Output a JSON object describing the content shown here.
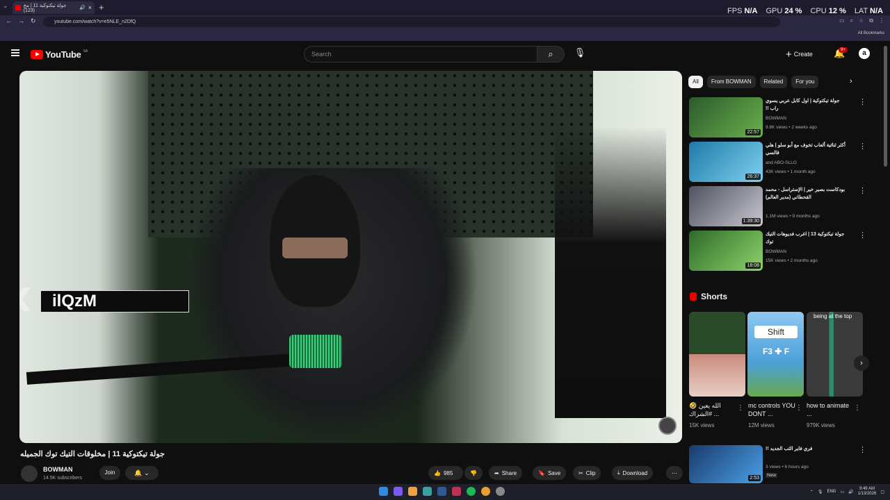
{
  "browser": {
    "tab_title": "جولة تيكتوكية 11 | مخ (123)",
    "url": "youtube.com/watch?v=e5NLE_n2DfQ",
    "bookmarks_label": "All Bookmarks",
    "perf": [
      {
        "label": "FPS",
        "value": "N/A"
      },
      {
        "label": "GPU",
        "value": "24 %"
      },
      {
        "label": "CPU",
        "value": "12 %"
      },
      {
        "label": "LAT",
        "value": "N/A"
      }
    ]
  },
  "header": {
    "logo_text": "YouTube",
    "country": "SA",
    "search_placeholder": "Search",
    "create_label": "Create",
    "notif_badge": "9+",
    "avatar_letter": "a"
  },
  "video": {
    "overlay_name": "ilQzM",
    "title": "جولة تيكتوكية 11 | مخلوقات التيك توك الجميله",
    "channel": "BOWMAN",
    "subscribers": "14.5K subscribers",
    "join_label": "Join",
    "like_count": "985",
    "share_label": "Share",
    "save_label": "Save",
    "clip_label": "Clip",
    "download_label": "Download"
  },
  "chips": [
    "All",
    "From BOWMAN",
    "Related",
    "For you"
  ],
  "recommendations": [
    {
      "title": "جولة تيكتوكية | اول كابل عربي يسوي راب !!",
      "channel": "BOWMAN",
      "meta": "9.8K views • 2 weeks ago",
      "duration": "22:57",
      "color": "#3d7a3d"
    },
    {
      "title": "أكثر ثنائية ألعاب تخوف مع أبو سلو | هلي قالسي",
      "channel": "and ABO-SLLO",
      "meta": "43K views • 1 month ago",
      "duration": "26:37",
      "color": "#3aa0c9"
    },
    {
      "title": "بودكاست بصير خير | الإستراسل - محمد القحطاني (مدير العالم)",
      "channel": "",
      "meta": "1.1M views • 9 months ago",
      "duration": "1:39:30",
      "color": "#6a6a7a"
    },
    {
      "title": "جولة تيكتوكية 13 | اغرب فديوهات التيك توك",
      "channel": "BOWMAN",
      "meta": "15K views • 2 months ago",
      "duration": "18:08",
      "color": "#4f8a3a"
    }
  ],
  "shorts_label": "Shorts",
  "shorts": [
    {
      "title": "الله يعين 🤣 #الشراك ...",
      "views": "15K views",
      "color": "#6b3d3d"
    },
    {
      "title": "mc controls YOU DONT ...",
      "views": "12M views",
      "color": "#4a9ad0",
      "overlay": "Shift",
      "keys": "F3 ✚ F"
    },
    {
      "title": "how to animate ...",
      "views": "979K views",
      "color": "#5a5a5a",
      "overlay": "being at the top"
    }
  ],
  "extra_rec": {
    "title": "فري فاير الثب الجديد !!",
    "channel": "",
    "meta": "3 views • 6 hours ago",
    "badge": "New",
    "duration": "2:53",
    "color": "#2b5a8a"
  },
  "taskbar": {
    "lang": "ENG",
    "time": "9:49 AM",
    "date": "1/13/2026"
  }
}
